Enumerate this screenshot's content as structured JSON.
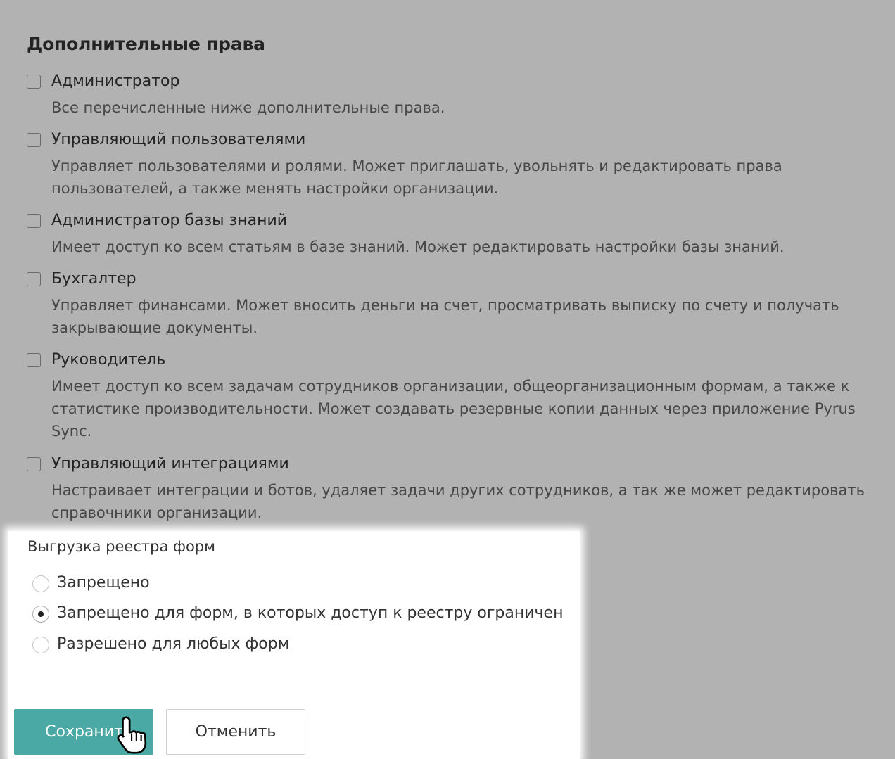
{
  "section_title": "Дополнительные права",
  "permissions": [
    {
      "name": "Администратор",
      "description": "Все перечисленные ниже дополнительные права.",
      "checked": false
    },
    {
      "name": "Управляющий пользователями",
      "description": "Управляет пользователями и ролями. Может приглашать, увольнять и редактировать права пользователей, а также менять настройки организации.",
      "checked": false
    },
    {
      "name": "Администратор базы знаний",
      "description": "Имеет доступ ко всем статьям в базе знаний. Может редактировать настройки базы знаний.",
      "checked": false
    },
    {
      "name": "Бухгалтер",
      "description": "Управляет финансами. Может вносить деньги на счет, просматривать выписку по счету и получать закрывающие документы.",
      "checked": false
    },
    {
      "name": "Руководитель",
      "description": "Имеет доступ ко всем задачам сотрудников организации, общеорганизационным формам, а также к статистике производительности. Может создавать резервные копии данных через приложение Pyrus Sync.",
      "checked": false
    },
    {
      "name": "Управляющий интеграциями",
      "description": "Настраивает интеграции и ботов, удаляет задачи других сотрудников, а так же может редактировать справочники организации.",
      "checked": false
    }
  ],
  "form_export": {
    "title": "Выгрузка реестра форм",
    "options": [
      {
        "label": "Запрещено",
        "selected": false
      },
      {
        "label": "Запрещено для форм, в которых доступ к реестру ограничен",
        "selected": true
      },
      {
        "label": "Разрешено для любых форм",
        "selected": false
      }
    ]
  },
  "buttons": {
    "save": "Сохранить",
    "cancel": "Отменить"
  },
  "colors": {
    "accent": "#4aa9a5",
    "overlay": "rgba(0,0,0,0.30)"
  }
}
